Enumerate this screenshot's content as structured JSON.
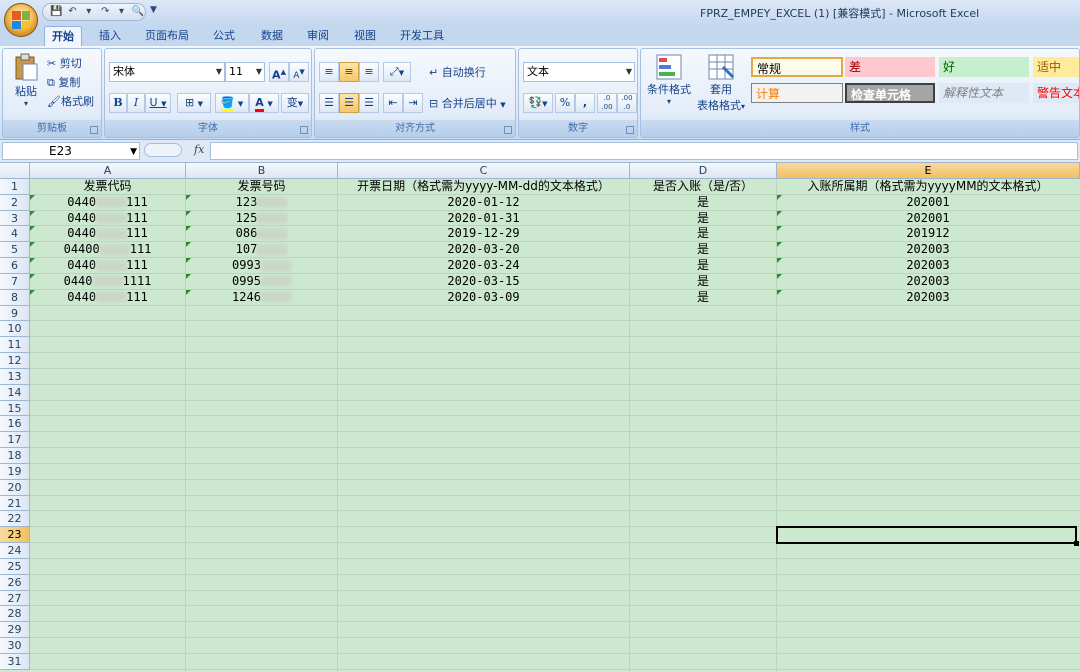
{
  "window": {
    "title": "FPRZ_EMPEY_EXCEL (1) [兼容模式] - Microsoft Excel"
  },
  "ribbon_tabs": [
    "开始",
    "插入",
    "页面布局",
    "公式",
    "数据",
    "审阅",
    "视图",
    "开发工具"
  ],
  "clipboard": {
    "paste": "粘贴",
    "cut": "剪切",
    "copy": "复制",
    "format_painter": "格式刷",
    "label": "剪贴板"
  },
  "font": {
    "name": "宋体",
    "size": "11",
    "grow": "A",
    "shrink": "A",
    "bold": "B",
    "italic": "I",
    "underline": "U",
    "font_color_glyph": "A",
    "phonetic_glyph": "变",
    "label": "字体"
  },
  "alignment": {
    "wrap_text": "自动换行",
    "merge_center": "合并后居中",
    "label": "对齐方式"
  },
  "number": {
    "format": "文本",
    "percent": "%",
    "comma": ",",
    "inc_decimal": ".0 .00",
    "dec_decimal": ".00 .0",
    "label": "数字"
  },
  "styles": {
    "conditional": "条件格式",
    "table_format_line1": "套用",
    "table_format_line2": "表格格式",
    "cells": [
      {
        "text": "常规",
        "bg": "#fffbe9",
        "color": "#000000"
      },
      {
        "text": "差",
        "bg": "#ffc7ce",
        "color": "#9c0006"
      },
      {
        "text": "好",
        "bg": "#c6efce",
        "color": "#006100"
      },
      {
        "text": "适中",
        "bg": "#ffeb9c",
        "color": "#9c5700"
      },
      {
        "text": "计算",
        "bg": "#f2f2f2",
        "color": "#fa7d00"
      },
      {
        "text": "检查单元格",
        "bg": "#a5a5a5",
        "color": "#ffffff"
      },
      {
        "text": "解释性文本",
        "bg": "#dfe9f5",
        "color": "#7f7f7f"
      },
      {
        "text": "警告文本",
        "bg": "#dfe9f5",
        "color": "#ff0000"
      }
    ],
    "label": "样式"
  },
  "formula_bar": {
    "name_box": "E23",
    "fx": "fx",
    "formula": ""
  },
  "sheet": {
    "columns": [
      "A",
      "B",
      "C",
      "D",
      "E"
    ],
    "selected_column": "E",
    "selected_row": "23",
    "row_numbers": [
      "1",
      "2",
      "3",
      "4",
      "5",
      "6",
      "7",
      "8",
      "9",
      "10",
      "11",
      "12",
      "13",
      "14",
      "15",
      "16",
      "17",
      "18",
      "19",
      "20",
      "21",
      "22",
      "23",
      "24",
      "25",
      "26",
      "27",
      "28",
      "29",
      "30",
      "31"
    ],
    "header_row": [
      "发票代码",
      "发票号码",
      "开票日期（格式需为yyyy-MM-dd的文本格式）",
      "是否入账（是/否）",
      "入账所属期（格式需为yyyyMM的文本格式）"
    ],
    "rows": [
      {
        "a_prefix": "0440",
        "a_suffix": "111",
        "b_prefix": "123",
        "c": "2020-01-12",
        "d": "是",
        "e": "202001"
      },
      {
        "a_prefix": "0440",
        "a_suffix": "111",
        "b_prefix": "125",
        "c": "2020-01-31",
        "d": "是",
        "e": "202001"
      },
      {
        "a_prefix": "0440",
        "a_suffix": "111",
        "b_prefix": "086",
        "c": "2019-12-29",
        "d": "是",
        "e": "201912"
      },
      {
        "a_prefix": "04400",
        "a_suffix": "111",
        "b_prefix": "107",
        "c": "2020-03-20",
        "d": "是",
        "e": "202003"
      },
      {
        "a_prefix": "0440",
        "a_suffix": "111",
        "b_prefix": "0993",
        "c": "2020-03-24",
        "d": "是",
        "e": "202003"
      },
      {
        "a_prefix": "0440",
        "a_suffix": "1111",
        "b_prefix": "0995",
        "c": "2020-03-15",
        "d": "是",
        "e": "202003"
      },
      {
        "a_prefix": "0440",
        "a_suffix": "111",
        "b_prefix": "1246",
        "c": "2020-03-09",
        "d": "是",
        "e": "202003"
      }
    ],
    "grid_background": "#cce8cf",
    "error_indicator_color": "#2e8b2e"
  }
}
